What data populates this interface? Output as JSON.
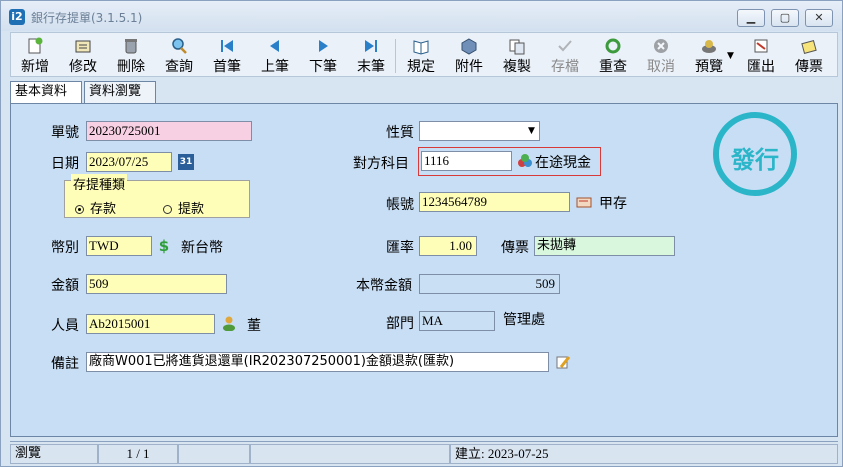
{
  "window": {
    "title": "銀行存提單(3.1.5.1)",
    "app_icon": "i2",
    "min": "▁",
    "max": "▢",
    "close": "✕"
  },
  "toolbar": {
    "items": [
      {
        "label": "新增",
        "icon": "new-doc-icon"
      },
      {
        "label": "修改",
        "icon": "edit-icon"
      },
      {
        "label": "刪除",
        "icon": "trash-icon"
      },
      {
        "label": "查詢",
        "icon": "search-icon"
      },
      {
        "label": "首筆",
        "icon": "first-icon"
      },
      {
        "label": "上筆",
        "icon": "prev-icon"
      },
      {
        "label": "下筆",
        "icon": "next-icon"
      },
      {
        "label": "末筆",
        "icon": "last-icon"
      },
      {
        "label": "規定",
        "icon": "book-icon"
      },
      {
        "label": "附件",
        "icon": "attachment-icon"
      },
      {
        "label": "複製",
        "icon": "copy-icon"
      },
      {
        "label": "存檔",
        "icon": "save-icon",
        "disabled": true
      },
      {
        "label": "重查",
        "icon": "refresh-icon"
      },
      {
        "label": "取消",
        "icon": "cancel-icon",
        "disabled": true
      },
      {
        "label": "預覽",
        "icon": "preview-icon"
      },
      {
        "label": "匯出",
        "icon": "export-icon"
      },
      {
        "label": "傳票",
        "icon": "voucher-icon"
      }
    ]
  },
  "tabs": [
    {
      "label": "基本資料",
      "active": true
    },
    {
      "label": "資料瀏覽",
      "active": false
    }
  ],
  "form": {
    "doc_no_label": "單號",
    "doc_no": "20230725001",
    "date_label": "日期",
    "date": "2023/07/25",
    "calendar_icon": "31",
    "dep_type_title": "存提種類",
    "deposit": "存款",
    "withdraw": "提款",
    "currency_label": "幣別",
    "currency": "TWD",
    "currency_name": "新台幣",
    "amount_label": "金額",
    "amount": "509",
    "staff_label": "人員",
    "staff": "Ab2015001",
    "staff_name": "董",
    "note_label": "備註",
    "note": "廠商W001已將進貨退還單(IR202307250001)金額退款(匯款)",
    "nature_label": "性質",
    "nature": "",
    "counter_acct_label": "對方科目",
    "counter_acct": "1116",
    "counter_acct_name": "在途現金",
    "account_no_label": "帳號",
    "account_no": "1234564789",
    "account_name": "甲存",
    "rate_label": "匯率",
    "rate": "1.00",
    "voucher_label": "傳票",
    "voucher": "未拋轉",
    "local_amount_label": "本幣金額",
    "local_amount": "509",
    "dept_label": "部門",
    "dept": "MA",
    "dept_name": "管理處",
    "stamp": "發行"
  },
  "status": {
    "mode": "瀏覽",
    "record": "1 / 1",
    "created": "建立: 2023-07-25"
  },
  "colors": {
    "pink_field": "#f8d0e3",
    "yellow_field": "#fffeb8",
    "stamp": "#2bb5c9",
    "panel": "#c8def5"
  }
}
